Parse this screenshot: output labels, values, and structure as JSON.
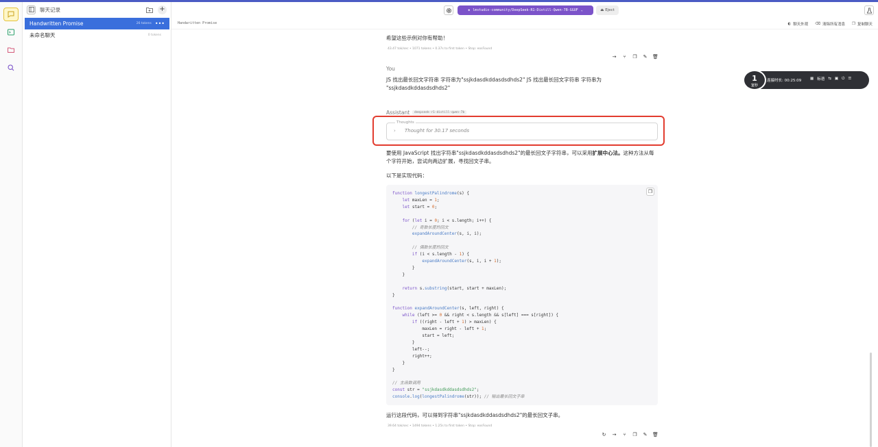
{
  "sidebar": {
    "header_label": "聊天记录",
    "items": [
      {
        "title": "Handwritten Promise",
        "tokens": "26 tokens",
        "active": true
      },
      {
        "title": "未命名聊天",
        "tokens": "0 tokens",
        "active": false
      }
    ]
  },
  "topbar": {
    "model": "lmstudio-community/DeepSeek-R1-Distill-Qwen-7B-GGUF",
    "eject_label": "Eject"
  },
  "subbar": {
    "chat_title": "Handwritten Promise",
    "actions": [
      "聊天外观",
      "清除所有消息",
      "复制聊天"
    ]
  },
  "conversation": {
    "prev_assistant_text": "希望这些示例对你有帮助！",
    "prev_stats": "43.47 tok/sec • 1071 tokens • 0.37s to first token • Stop: eosFound",
    "user_label": "You",
    "user_text": "JS 找出最长回文字符串  字符串为\"ssjkdasdkddasdsdhds2\" JS 找出最长回文字符串  字符串为 \"ssjkdasdkddasdsdhds2\"",
    "assistant_label": "Assistant",
    "assistant_model_tag": "deepseek-r1-distill-qwen-7b",
    "thoughts_legend": "Thoughts",
    "thoughts_text": "Thought for 30.17 seconds",
    "intro_part1": "要使用 JavaScript 找出字符串\"ssjkdasdkddasdsdhds2\"的最长回文子字符串，可以采用",
    "intro_bold": "扩展中心法。",
    "intro_part2": "这种方法从每个字符开始，尝试向两边扩展，寻找回文子串。",
    "code_intro": "以下是实现代码：",
    "closing_text": "运行这段代码，可以得到字符串\"ssjkdasdkddasdsdhds2\"的最长回文子串。",
    "final_stats": "39.64 tok/sec • 1494 tokens • 1.25s to first token • Stop: eosFound"
  },
  "code": {
    "lines": [
      "function longestPalindrome(s) {",
      "    let maxLen = 1;",
      "    let start = 0;",
      "",
      "    for (let i = 0; i < s.length; i++) {",
      "        // 奇数长度的回文",
      "        expandAroundCenter(s, i, i);",
      "",
      "        // 偶数长度的回文",
      "        if (i < s.length - 1) {",
      "            expandAroundCenter(s, i, i + 1);",
      "        }",
      "    }",
      "",
      "    return s.substring(start, start + maxLen);",
      "}",
      "",
      "function expandAroundCenter(s, left, right) {",
      "    while (left >= 0 && right < s.length && s[left] === s[right]) {",
      "        if ((right - left + 1) > maxLen) {",
      "            maxLen = right - left + 1;",
      "            start = left;",
      "        }",
      "        left--;",
      "        right++;",
      "    }",
      "}",
      "",
      "// 主函数调用",
      "const str = \"ssjkdasdkddasdsdhds2\";",
      "console.log(longestPalindrome(str)); // 输出最长回文子串"
    ]
  },
  "overlay": {
    "badge_number": "1",
    "badge_label": "室秒",
    "connection_text": "连接时长: 00:25:09",
    "item_label": "标语"
  },
  "colors": {
    "accent": "#3a6fdc",
    "model_pill": "#7b53c9",
    "highlight": "#e23b2e"
  }
}
